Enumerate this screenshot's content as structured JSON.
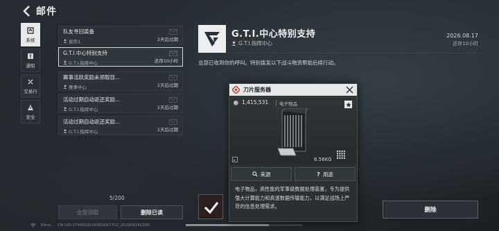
{
  "header": {
    "title": "邮件"
  },
  "tabs": [
    {
      "label": "系统",
      "icon": "system-icon",
      "active": true
    },
    {
      "label": "通知",
      "icon": "notice-icon",
      "active": false
    },
    {
      "label": "交易行",
      "icon": "trade-icon",
      "active": false
    },
    {
      "label": "安全",
      "icon": "security-icon",
      "active": false
    }
  ],
  "mails": [
    {
      "title": "队友寻回装备",
      "sender": "鼠壳1",
      "expire": "2天后过期"
    },
    {
      "title": "G.T.I.中心特别支持",
      "sender": "G.T.I.指挥中心",
      "expire": "还存10小时"
    },
    {
      "title": "赛事活跃奖励未领取目...",
      "sender": "赛事中心",
      "expire": "1天后过期"
    },
    {
      "title": "活动过期自动返还奖励...",
      "sender": "G.T.I.指挥中心",
      "expire": "1天后过期"
    },
    {
      "title": "活动过期自动返还奖励...",
      "sender": "G.T.I.指挥中心",
      "expire": "1天后过期"
    }
  ],
  "list_footer": {
    "counter": "5/200",
    "claim_all": "全部领取",
    "delete_read": "删除已读"
  },
  "status_bar": {
    "ping": "39ms",
    "uid": "CN UID:2749918105952667702_202608181030"
  },
  "detail": {
    "title": "G.T.I.中心特别支持",
    "sender": "G.T.I.指挥中心",
    "date": "2026.08.17",
    "remaining": "还存10小时",
    "body": "总部已收到你的呼叫。特别拨发以下战斗物资帮助后续行动。",
    "delete_label": "删除"
  },
  "item": {
    "name": "刀片服务器",
    "price": "1,415,531",
    "category": "电子物品",
    "weight": "6.56KG",
    "source_label": "来源",
    "usage_label": "用途",
    "description": "电子物品，高性能的军事级数据处理装置，专为提供强大计算能力和高速数据传输能力，以满足战场上严苛的信息处理需求。",
    "rarity_color": "#c0392b"
  },
  "colors": {
    "background": "#1d2226",
    "panel": "#2c3237",
    "accent_light": "#e7e9ea"
  }
}
